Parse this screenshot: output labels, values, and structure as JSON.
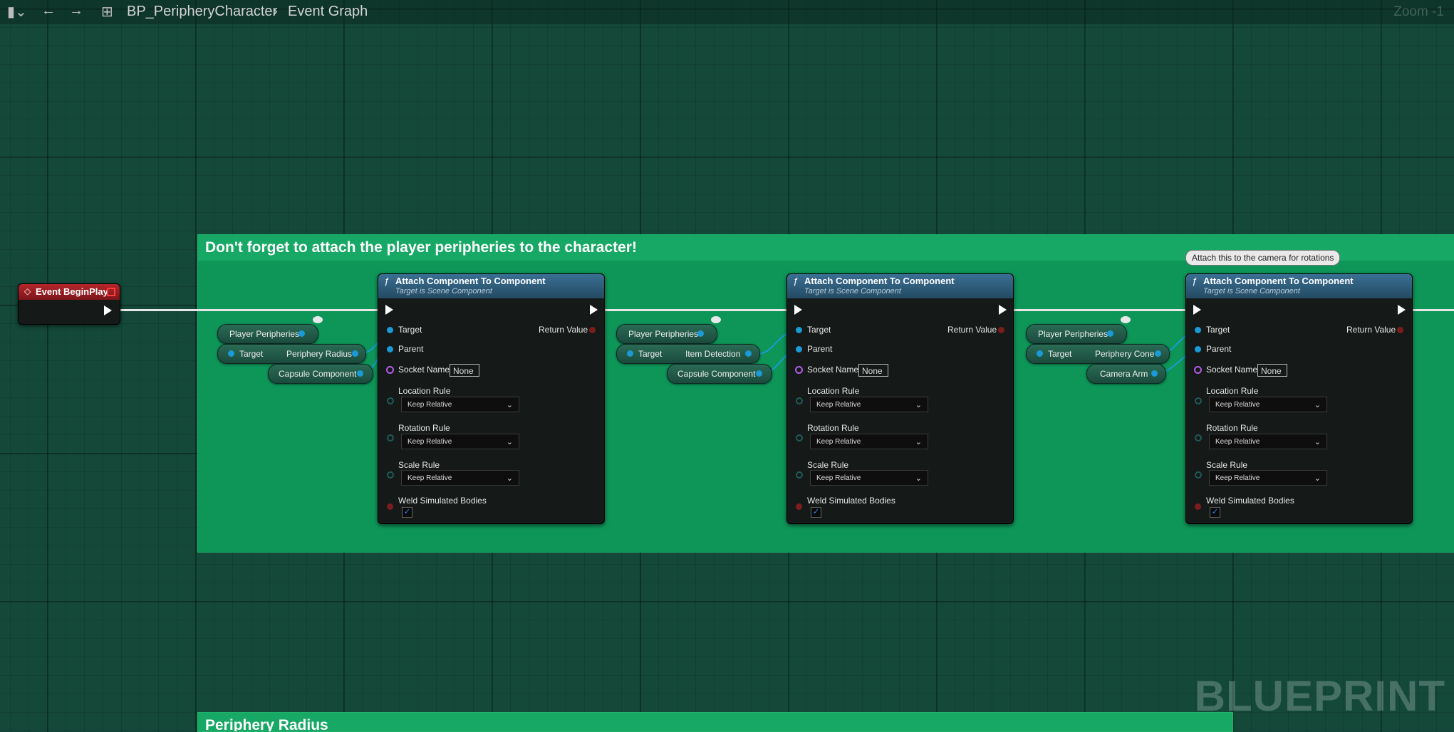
{
  "toolbar": {
    "breadcrumb_asset": "BP_PeripheryCharacter",
    "breadcrumb_graph": "Event Graph",
    "zoom_label": "Zoom -1"
  },
  "comments": [
    {
      "title": "Don't forget to attach the player peripheries to the character!"
    },
    {
      "title": "Periphery Radius"
    }
  ],
  "event_node": {
    "title": "Event BeginPlay"
  },
  "attach_nodes": [
    {
      "title": "Attach Component To Component",
      "subtitle": "Target is Scene Component",
      "target": "Target",
      "parent": "Parent",
      "return_value": "Return Value",
      "socket_label": "Socket Name",
      "socket_value": "None",
      "location_label": "Location Rule",
      "location_value": "Keep Relative",
      "rotation_label": "Rotation Rule",
      "rotation_value": "Keep Relative",
      "scale_label": "Scale Rule",
      "scale_value": "Keep Relative",
      "weld_label": "Weld Simulated Bodies",
      "weld_checked": "✓"
    },
    {
      "title": "Attach Component To Component",
      "subtitle": "Target is Scene Component",
      "target": "Target",
      "parent": "Parent",
      "return_value": "Return Value",
      "socket_label": "Socket Name",
      "socket_value": "None",
      "location_label": "Location Rule",
      "location_value": "Keep Relative",
      "rotation_label": "Rotation Rule",
      "rotation_value": "Keep Relative",
      "scale_label": "Scale Rule",
      "scale_value": "Keep Relative",
      "weld_label": "Weld Simulated Bodies",
      "weld_checked": "✓"
    },
    {
      "title": "Attach Component To Component",
      "subtitle": "Target is Scene Component",
      "target": "Target",
      "parent": "Parent",
      "return_value": "Return Value",
      "socket_label": "Socket Name",
      "socket_value": "None",
      "location_label": "Location Rule",
      "location_value": "Keep Relative",
      "rotation_label": "Rotation Rule",
      "rotation_value": "Keep Relative",
      "scale_label": "Scale Rule",
      "scale_value": "Keep Relative",
      "weld_label": "Weld Simulated Bodies",
      "weld_checked": "✓"
    }
  ],
  "var_groups": [
    {
      "peripheries": "Player Peripheries",
      "target": "Target",
      "getter": "Periphery Radius",
      "component": "Capsule Component"
    },
    {
      "peripheries": "Player Peripheries",
      "target": "Target",
      "getter": "Item Detection",
      "component": "Capsule Component"
    },
    {
      "peripheries": "Player Peripheries",
      "target": "Target",
      "getter": "Periphery Cone",
      "component": "Camera Arm"
    }
  ],
  "tooltip": "Attach this to the camera for rotations",
  "watermark": "BLUEPRINT",
  "colors": {
    "graph_bg": "#14493a",
    "comment": "#0f9a5b",
    "event_head": "#b3262a",
    "function_head": "#3a6f93",
    "object_pin": "#1a9ad6"
  }
}
